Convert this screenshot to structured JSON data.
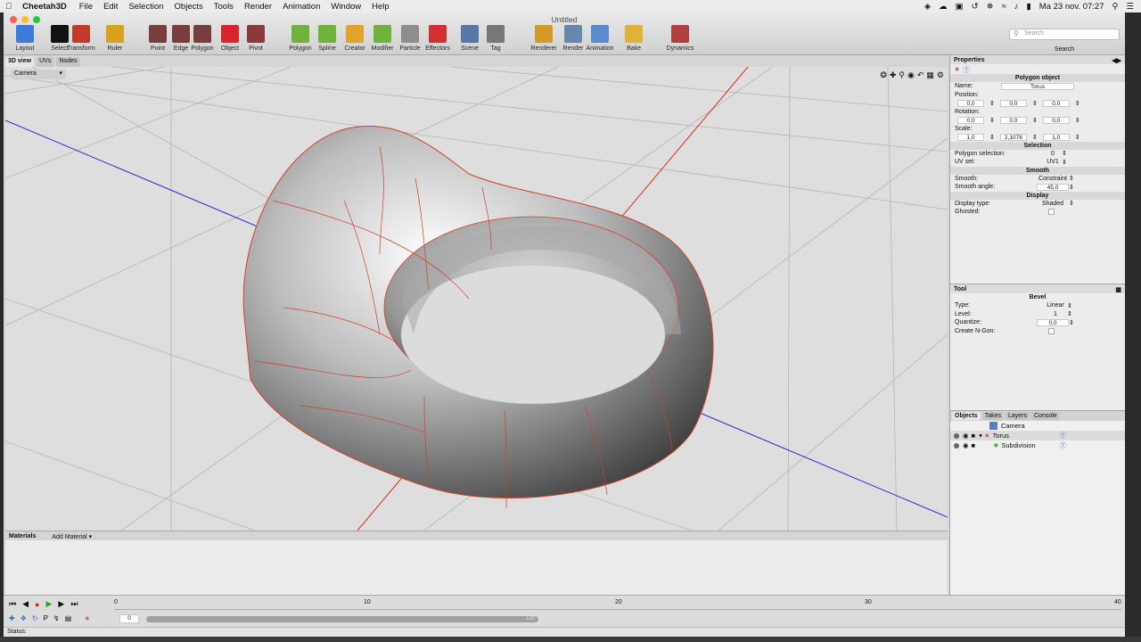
{
  "menubar": {
    "app": "Cheetah3D",
    "items": [
      "File",
      "Edit",
      "Selection",
      "Objects",
      "Tools",
      "Render",
      "Animation",
      "Window",
      "Help"
    ],
    "datetime": "Ma 23 nov.  07:27"
  },
  "window": {
    "title": "Untitled"
  },
  "toolbar": {
    "groups": [
      {
        "label": "Layout",
        "icon": "layout-icon",
        "color": "#3d7bd8"
      },
      {
        "label": "Select",
        "icon": "cursor-arrow-icon",
        "color": "#111111"
      },
      {
        "label": "Transform",
        "icon": "transform-icon",
        "color": "#c43a2a"
      },
      {
        "label": "Ruler",
        "icon": "ruler-icon",
        "color": "#d9a21b"
      },
      {
        "label": "Point",
        "icon": "point-mode-icon",
        "color": "#7a3d3d"
      },
      {
        "label": "Edge",
        "icon": "edge-mode-icon",
        "color": "#7a3d3d"
      },
      {
        "label": "Polygon",
        "icon": "polygon-mode-icon",
        "color": "#7a3d3d"
      },
      {
        "label": "Object",
        "icon": "object-mode-icon",
        "color": "#d8242a"
      },
      {
        "label": "Pivot",
        "icon": "pivot-icon",
        "color": "#8a3a3a"
      },
      {
        "label": "Polygon",
        "icon": "polygon-cube-icon",
        "color": "#6fb33b"
      },
      {
        "label": "Spline",
        "icon": "spline-icon",
        "color": "#6fb33b"
      },
      {
        "label": "Creator",
        "icon": "creator-icon",
        "color": "#e2a32a"
      },
      {
        "label": "Modifier",
        "icon": "modifier-icon",
        "color": "#6fb33b"
      },
      {
        "label": "Particle",
        "icon": "particle-icon",
        "color": "#8d8d8d"
      },
      {
        "label": "Effectors",
        "icon": "effectors-icon",
        "color": "#d23030"
      },
      {
        "label": "Scene",
        "icon": "scene-camera-icon",
        "color": "#5577aa"
      },
      {
        "label": "Tag",
        "icon": "tag-icon",
        "color": "#777777"
      },
      {
        "label": "Renderer",
        "icon": "renderer-cheetah-icon",
        "color": "#d39a2a"
      },
      {
        "label": "Render",
        "icon": "render-camera-icon",
        "color": "#6688aa"
      },
      {
        "label": "Animation",
        "icon": "animation-clapper-icon",
        "color": "#5a8ad0"
      },
      {
        "label": "Bake",
        "icon": "bake-icon",
        "color": "#e0b23a"
      },
      {
        "label": "Dynamics",
        "icon": "dynamics-icon",
        "color": "#b04040"
      }
    ],
    "search_placeholder": "Search",
    "search_label": "Search"
  },
  "viewtabs": [
    "3D view",
    "UVs",
    "Nodes"
  ],
  "viewport": {
    "camera": "Camera"
  },
  "materials": {
    "title": "Materials",
    "add": "Add Material"
  },
  "properties": {
    "title": "Properties",
    "object_header": "Polygon object",
    "name_label": "Name:",
    "name_value": "Torus",
    "position_label": "Position:",
    "position": [
      "0,0",
      "0,0",
      "0,0"
    ],
    "rotation_label": "Rotation:",
    "rotation": [
      "0,0",
      "0,0",
      "0,0"
    ],
    "scale_label": "Scale:",
    "scale": [
      "1,0",
      "2,1078",
      "1,0"
    ],
    "selection_header": "Selection",
    "polysel_label": "Polygon selection:",
    "polysel_value": "0",
    "uvset_label": "UV set:",
    "uvset_value": "UV1",
    "smooth_header": "Smooth",
    "smooth_label": "Smooth:",
    "smooth_value": "Constraint",
    "smoothangle_label": "Smooth angle:",
    "smoothangle_value": "45,0",
    "display_header": "Display",
    "displaytype_label": "Display type:",
    "displaytype_value": "Shaded",
    "ghosted_label": "Ghosted:"
  },
  "tool": {
    "title": "Tool",
    "header": "Bevel",
    "type_label": "Type:",
    "type_value": "Linear",
    "level_label": "Level:",
    "level_value": "1",
    "quantize_label": "Quantize:",
    "quantize_value": "0,0",
    "ngon_label": "Create N-Gon:"
  },
  "objects": {
    "tabs": [
      "Objects",
      "Takes",
      "Layers",
      "Console"
    ],
    "items": [
      {
        "name": "Camera"
      },
      {
        "name": "Torus"
      },
      {
        "name": "Subdivision"
      }
    ]
  },
  "timeline": {
    "ticks": [
      "0",
      "10",
      "20",
      "30",
      "40"
    ],
    "frame": "0",
    "range_end": "120"
  },
  "status": {
    "label": "Status:"
  }
}
